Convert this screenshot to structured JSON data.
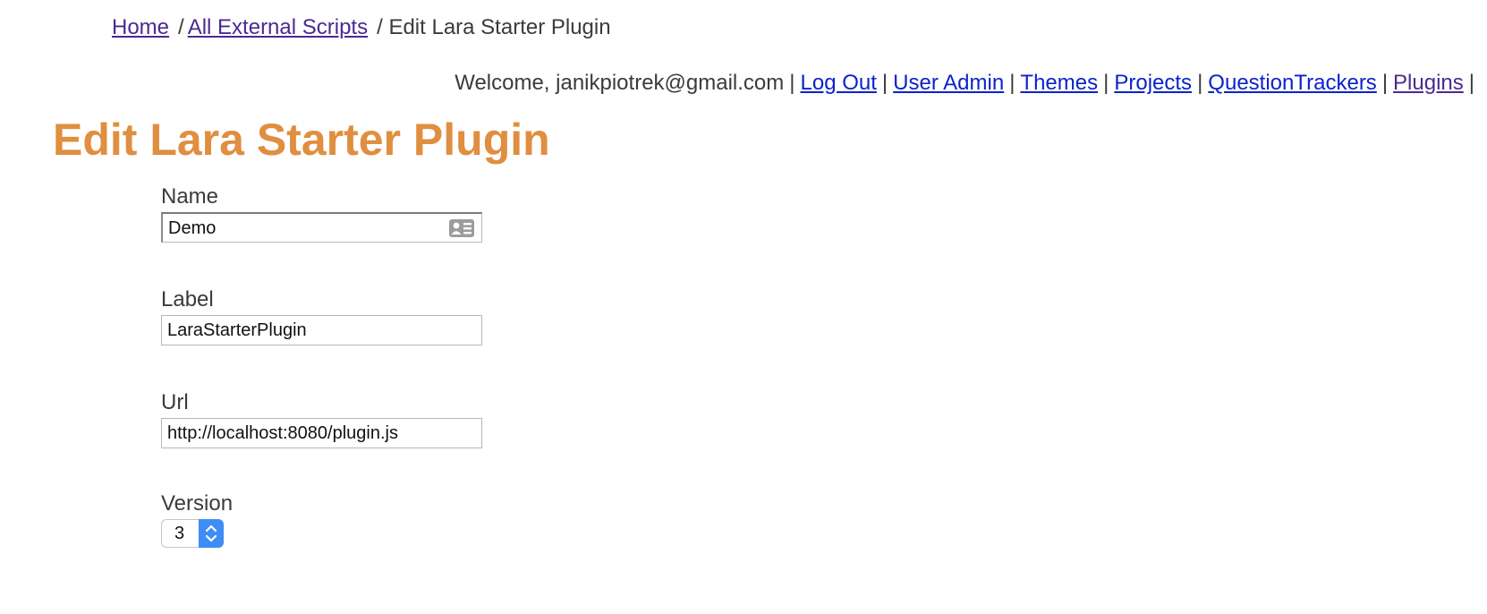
{
  "breadcrumb": {
    "home": "Home",
    "all_scripts": "All External Scripts",
    "sep1": "/",
    "sep2": "/",
    "current": "/ Edit Lara Starter Plugin"
  },
  "topnav": {
    "welcome": "Welcome, janikpiotrek@gmail.com",
    "separator": "|",
    "links": [
      "Log Out",
      "User Admin",
      "Themes",
      "Projects",
      "QuestionTrackers",
      "Plugins"
    ]
  },
  "page": {
    "title": "Edit Lara Starter Plugin"
  },
  "form": {
    "name": {
      "label": "Name",
      "value": "Demo"
    },
    "label": {
      "label": "Label",
      "value": "LaraStarterPlugin"
    },
    "url": {
      "label": "Url",
      "value": "http://localhost:8080/plugin.js"
    },
    "version": {
      "label": "Version",
      "value": "3"
    }
  },
  "colors": {
    "title": "#e08e40",
    "link": "#0b23c9",
    "visited_link": "#4b2a8f",
    "select_accent": "#3d8df5"
  },
  "icons": {
    "name_field": "contact-card-icon",
    "version_select": "stepper-arrows-icon"
  }
}
